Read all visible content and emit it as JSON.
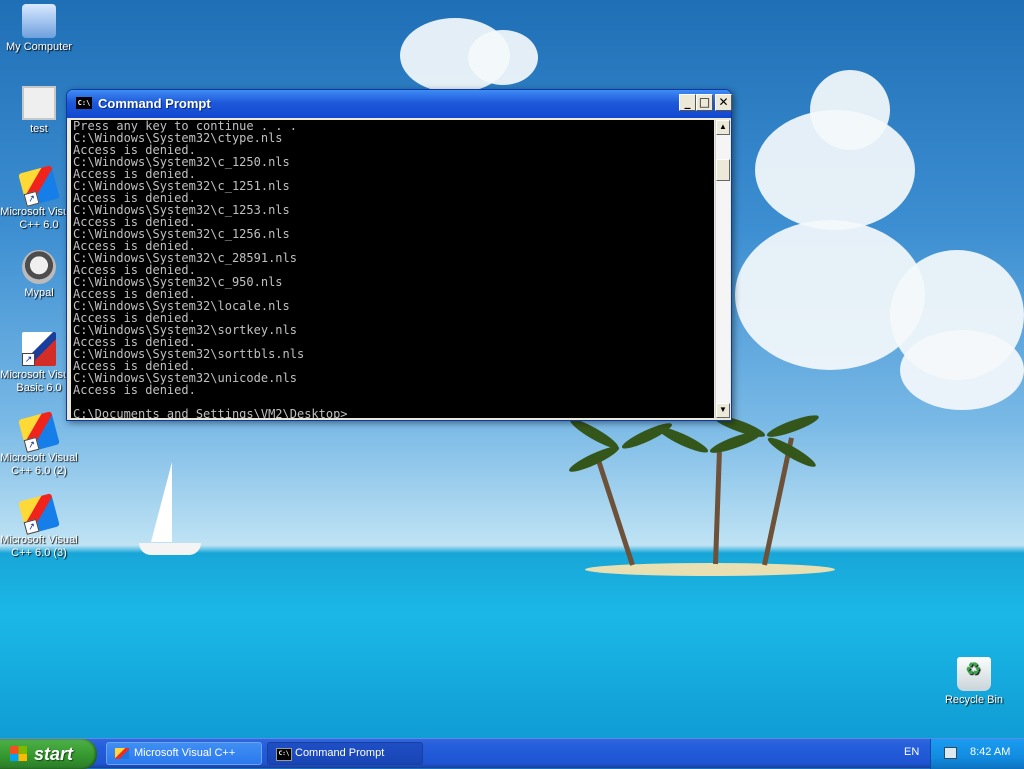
{
  "desktop": {
    "icons": [
      {
        "label": "My Computer",
        "icon": "computer-icon"
      },
      {
        "label": "test",
        "icon": "app-icon"
      },
      {
        "label": "Microsoft Visual C++ 6.0",
        "icon": "visual-cpp-icon"
      },
      {
        "label": "Mypal",
        "icon": "raccoon-icon"
      },
      {
        "label": "Microsoft Visual Basic 6.0",
        "icon": "visual-basic-icon"
      },
      {
        "label": "Microsoft Visual C++ 6.0 (2)",
        "icon": "visual-cpp-icon"
      },
      {
        "label": "Microsoft Visual C++ 6.0 (3)",
        "icon": "visual-cpp-icon"
      },
      {
        "label": "Recycle Bin",
        "icon": "recycle-bin-icon"
      }
    ]
  },
  "command_window": {
    "title": "Command Prompt",
    "icon_text": "C:\\",
    "control_labels": {
      "minimize": "_",
      "maximize": "□",
      "close": "✕"
    },
    "lines": [
      "Press any key to continue . . .",
      "C:\\Windows\\System32\\ctype.nls",
      "Access is denied.",
      "C:\\Windows\\System32\\c_1250.nls",
      "Access is denied.",
      "C:\\Windows\\System32\\c_1251.nls",
      "Access is denied.",
      "C:\\Windows\\System32\\c_1253.nls",
      "Access is denied.",
      "C:\\Windows\\System32\\c_1256.nls",
      "Access is denied.",
      "C:\\Windows\\System32\\c_28591.nls",
      "Access is denied.",
      "C:\\Windows\\System32\\c_950.nls",
      "Access is denied.",
      "C:\\Windows\\System32\\locale.nls",
      "Access is denied.",
      "C:\\Windows\\System32\\sortkey.nls",
      "Access is denied.",
      "C:\\Windows\\System32\\sorttbls.nls",
      "Access is denied.",
      "C:\\Windows\\System32\\unicode.nls",
      "Access is denied.",
      "",
      "C:\\Documents and Settings\\VM2\\Desktop>"
    ]
  },
  "taskbar": {
    "start_label": "start",
    "tasks": [
      {
        "label": "Microsoft Visual C++",
        "icon": "visual-cpp-icon"
      },
      {
        "label": "Command Prompt",
        "icon": "command-prompt-icon"
      }
    ],
    "language": "EN",
    "clock": "8:42 AM"
  },
  "colors": {
    "titlebar": "#1f59da",
    "taskbar": "#245edb",
    "start_button": "#35992f",
    "console_text": "#c0c0c0",
    "console_background": "#000000"
  }
}
